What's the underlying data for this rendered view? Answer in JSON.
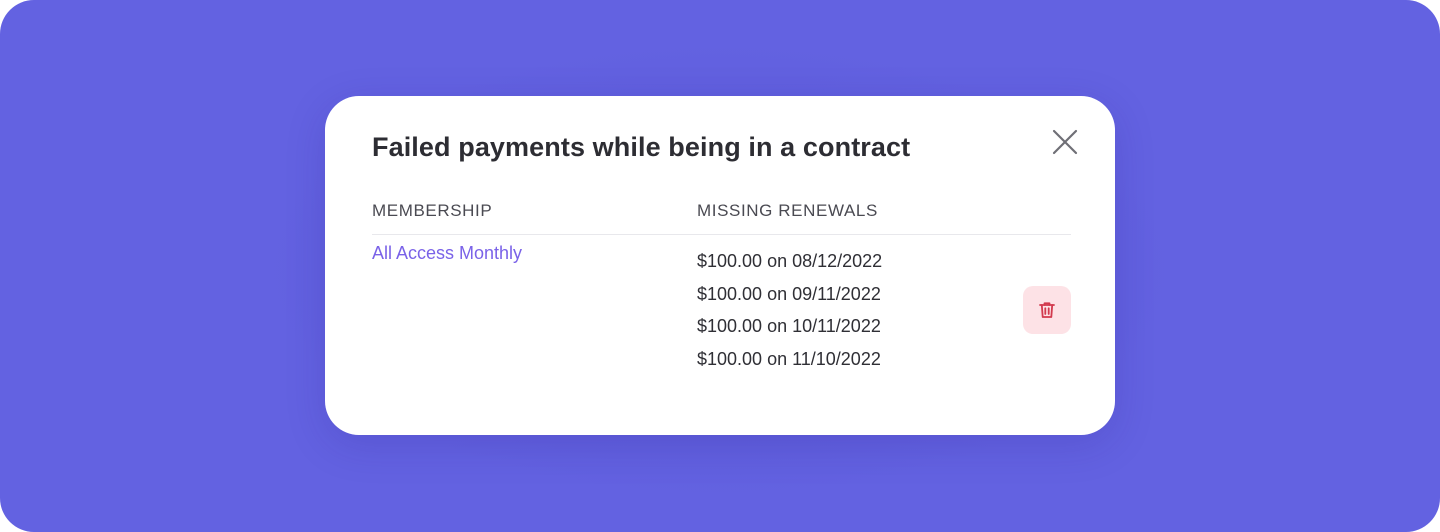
{
  "modal": {
    "title": "Failed payments while being in a contract",
    "close_icon": "close-icon"
  },
  "table": {
    "headers": [
      "MEMBERSHIP",
      "MISSING RENEWALS"
    ],
    "rows": [
      {
        "membership": "All Access Monthly",
        "renewals": [
          "$100.00 on 08/12/2022",
          "$100.00 on 09/11/2022",
          "$100.00 on 10/11/2022",
          "$100.00 on 11/10/2022"
        ],
        "action_icon": "trash-icon"
      }
    ]
  },
  "colors": {
    "backdrop": "#6362e1",
    "link": "#7a62e8",
    "delete_bg": "#fde2e6",
    "delete_icon": "#d23a4e"
  }
}
